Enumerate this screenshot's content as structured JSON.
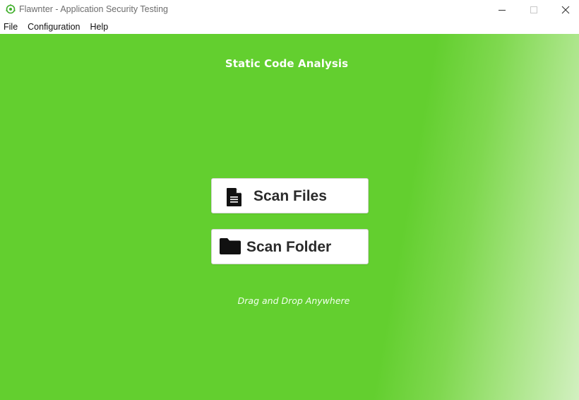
{
  "window": {
    "title": "Flawnter - Application Security Testing",
    "controls": {
      "minimize_icon": "minimize-icon",
      "maximize_icon": "maximize-icon",
      "close_icon": "close-icon"
    }
  },
  "menu": {
    "items": [
      {
        "label": "File"
      },
      {
        "label": "Configuration"
      },
      {
        "label": "Help"
      }
    ]
  },
  "main": {
    "title": "Static Code Analysis",
    "scan_files": {
      "label": "Scan Files",
      "icon": "file-icon"
    },
    "scan_folder": {
      "label": "Scan Folder",
      "icon": "folder-icon"
    },
    "hint": "Drag and Drop Anywhere"
  },
  "colors": {
    "accent_green": "#63cf2f",
    "button_bg": "#ffffff",
    "button_text": "#2b2b2b",
    "title_text": "#ffffff"
  }
}
